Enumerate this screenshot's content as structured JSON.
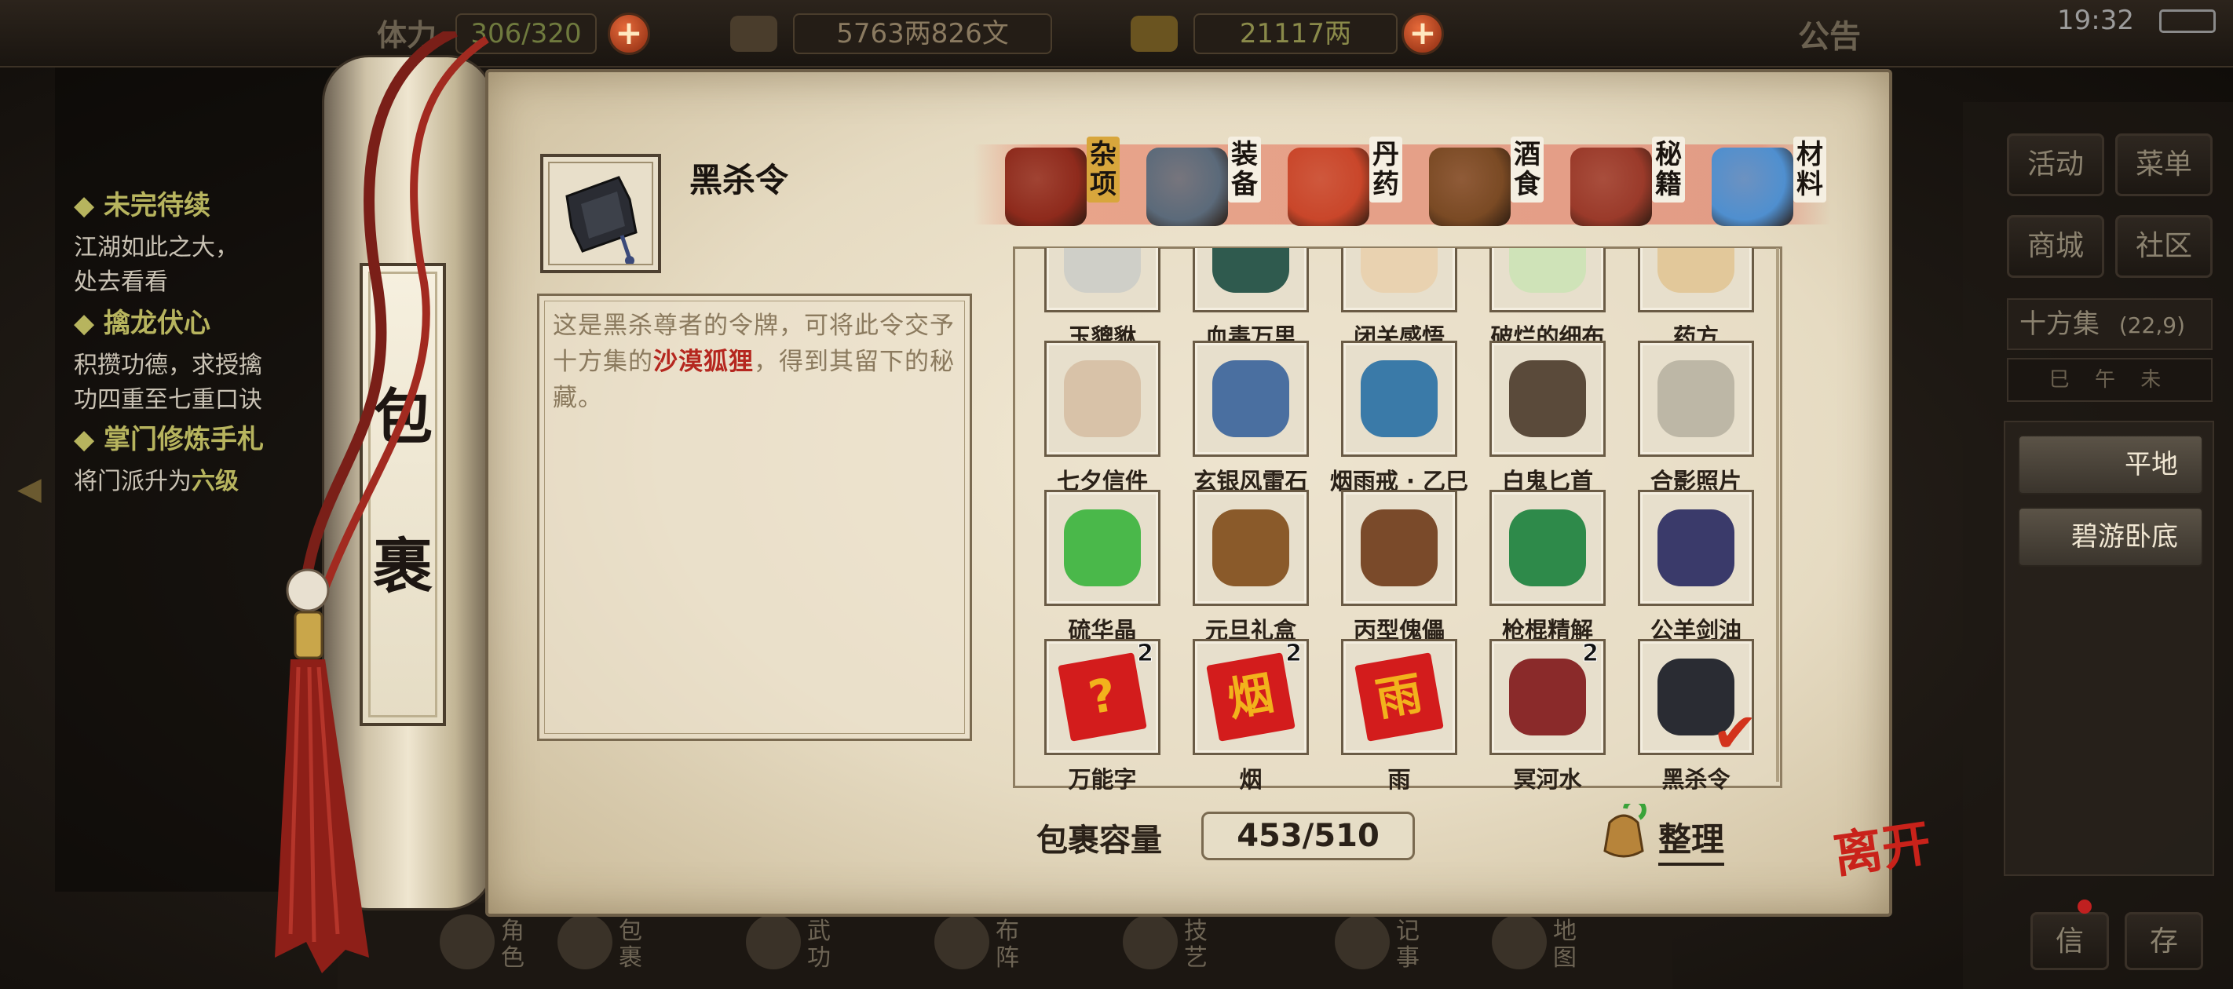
{
  "top_bar": {
    "stamina_label": "体力",
    "stamina_value": "306/320",
    "silver_value": "5763两826文",
    "gold_value": "21117两",
    "notice_label": "公告",
    "clock": "19:32"
  },
  "quests": [
    {
      "title": "未完待续",
      "lines": [
        "江湖如此之大，",
        "处去看看"
      ]
    },
    {
      "title": "擒龙伏心",
      "lines": [
        "积攒功德，求授擒",
        "功四重至七重口诀"
      ]
    },
    {
      "title": "掌门修炼手札",
      "lines": [
        "将门派升为"
      ],
      "highlight": "六级"
    }
  ],
  "side_menu": {
    "buttons": [
      "活动",
      "菜单",
      "商城",
      "社区"
    ],
    "location_name": "十方集",
    "location_coords": "(22,9)",
    "time_strip": "巳 午 未",
    "places": [
      "平地",
      "碧游卧底"
    ]
  },
  "bottom_nav": [
    "角色",
    "包裹",
    "武功",
    "布阵",
    "技艺",
    "记事",
    "地图"
  ],
  "bottom_right": [
    "信",
    "存"
  ],
  "scroll_title": [
    "包",
    "裹"
  ],
  "selected_item": {
    "name": "黑杀令",
    "desc_before": "这是黑杀尊者的令牌，可将此令交予十方集的",
    "desc_highlight": "沙漠狐狸",
    "desc_after": "，得到其留下的秘藏。"
  },
  "tabs": [
    {
      "label": "杂项",
      "icon": "jar-icon",
      "active": true
    },
    {
      "label": "装备",
      "icon": "weapon-icon",
      "active": false
    },
    {
      "label": "丹药",
      "icon": "pill-icon",
      "active": false
    },
    {
      "label": "酒食",
      "icon": "wine-icon",
      "active": false
    },
    {
      "label": "秘籍",
      "icon": "book-icon",
      "active": false
    },
    {
      "label": "材料",
      "icon": "crystal-icon",
      "active": false
    }
  ],
  "grid_rows": [
    [
      {
        "name": "玉貔貅",
        "icon": "jade-beast-icon",
        "count": ""
      },
      {
        "name": "血毒万里",
        "icon": "poison-flask-icon",
        "count": ""
      },
      {
        "name": "闭关感悟",
        "icon": "scroll-note-icon",
        "count": ""
      },
      {
        "name": "破烂的细布",
        "icon": "cloth-icon",
        "count": ""
      },
      {
        "name": "药方",
        "icon": "recipe-icon",
        "count": ""
      }
    ],
    [
      {
        "name": "七夕信件",
        "icon": "letter-icon",
        "count": ""
      },
      {
        "name": "玄银风雷石",
        "icon": "thunder-stone-icon",
        "count": ""
      },
      {
        "name": "烟雨戒 · 乙巳",
        "icon": "ring-icon",
        "count": ""
      },
      {
        "name": "白鬼匕首",
        "icon": "dagger-icon",
        "count": ""
      },
      {
        "name": "合影照片",
        "icon": "photo-icon",
        "count": ""
      }
    ],
    [
      {
        "name": "硫华晶",
        "icon": "sulfur-crystal-icon",
        "count": ""
      },
      {
        "name": "元旦礼盒",
        "icon": "gift-chest-icon",
        "count": ""
      },
      {
        "name": "丙型傀儡",
        "icon": "puppet-icon",
        "count": ""
      },
      {
        "name": "枪棍精解",
        "icon": "manual-icon",
        "count": ""
      },
      {
        "name": "公羊剑油",
        "icon": "oil-jar-icon",
        "count": ""
      }
    ],
    [
      {
        "name": "万能字",
        "icon": "question-card-icon",
        "count": "2",
        "glyph": "?"
      },
      {
        "name": "烟",
        "icon": "smoke-card-icon",
        "count": "2",
        "glyph": "烟"
      },
      {
        "name": "雨",
        "icon": "rain-card-icon",
        "count": "",
        "glyph": "雨"
      },
      {
        "name": "冥河水",
        "icon": "potion-bottle-icon",
        "count": "2"
      },
      {
        "name": "黑杀令",
        "icon": "black-token-icon",
        "count": "",
        "selected": true
      }
    ]
  ],
  "capacity": {
    "label": "包裹容量",
    "value": "453/510"
  },
  "sort_label": "整理",
  "leave_label": "离开"
}
